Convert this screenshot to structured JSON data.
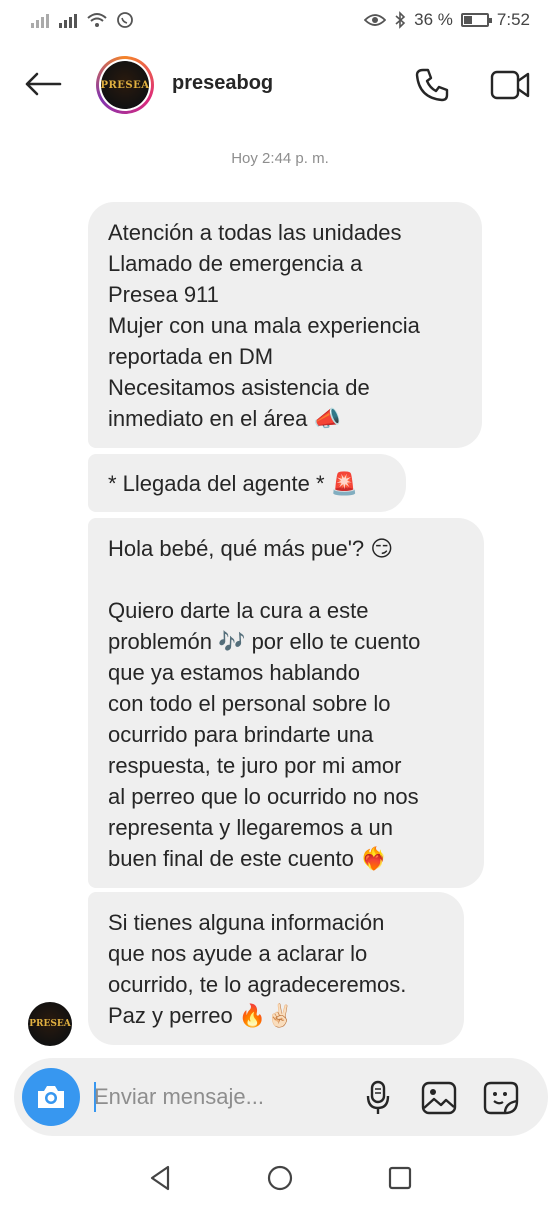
{
  "status_bar": {
    "battery_percent": "36 %",
    "battery_level": 0.36,
    "time": "7:52"
  },
  "header": {
    "username": "preseabog",
    "avatar_text": "PRESEA"
  },
  "thread": {
    "timestamp": "Hoy 2:44 p. m.",
    "messages": [
      {
        "text": "Atención a todas las unidades\nLlamado de emergencia a\nPresea 911\nMujer con una mala experiencia\nreportada en DM\nNecesitamos asistencia de\ninmediato en el área 📣"
      },
      {
        "text": "* Llegada del agente * 🚨"
      },
      {
        "text": "Hola bebé, qué más pue'? 😏\n\nQuiero darte la cura a este\nproblemón 🎶 por ello te cuento\nque ya estamos hablando\ncon todo el personal sobre lo\nocurrido para brindarte una\nrespuesta, te juro por mi amor\nal perreo que lo ocurrido no nos\nrepresenta y llegaremos a un\nbuen final de este cuento ❤️‍🔥"
      },
      {
        "text": "Si tienes alguna información\nque nos ayude a aclarar lo\nocurrido, te lo agradeceremos.\nPaz y perreo 🔥✌🏻"
      }
    ]
  },
  "composer": {
    "placeholder": "Enviar mensaje..."
  },
  "colors": {
    "accent": "#3797f0",
    "bubble": "#efefef",
    "text": "#262626",
    "muted": "#8e8e8e"
  },
  "icons": [
    "back-arrow-icon",
    "phone-icon",
    "video-camera-icon",
    "camera-icon",
    "microphone-icon",
    "gallery-icon",
    "sticker-icon",
    "nav-back-icon",
    "nav-home-icon",
    "nav-recent-icon",
    "wifi-icon",
    "signal-icon",
    "whatsapp-icon",
    "eye-icon",
    "bluetooth-icon"
  ]
}
